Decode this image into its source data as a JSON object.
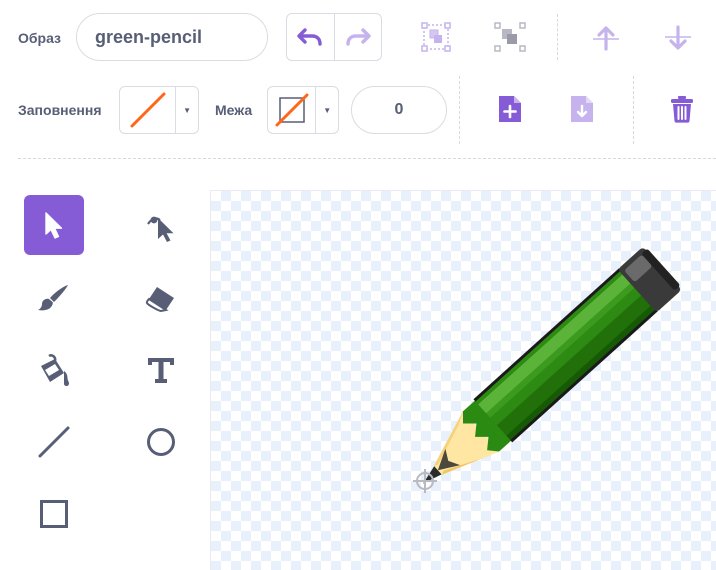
{
  "costume": {
    "label": "Образ",
    "name": "green-pencil"
  },
  "fill": {
    "label": "Заповнення",
    "color": "#ff6619"
  },
  "outline": {
    "label": "Межа",
    "color": "#ff6619",
    "width": "0"
  },
  "toolbar": {
    "undo_icon": "undo-icon",
    "redo_icon": "redo-icon",
    "group_icon": "group-icon",
    "ungroup_icon": "ungroup-icon",
    "forward_icon": "arrow-up-icon",
    "backward_icon": "arrow-down-icon",
    "paste_icon": "page-add-icon",
    "copy_icon": "page-download-icon",
    "delete_icon": "trash-icon"
  },
  "tools": [
    {
      "name": "select",
      "icon": "cursor-icon",
      "active": true
    },
    {
      "name": "reshape",
      "icon": "reshape-icon",
      "active": false
    },
    {
      "name": "brush",
      "icon": "brush-icon",
      "active": false
    },
    {
      "name": "eraser",
      "icon": "eraser-icon",
      "active": false
    },
    {
      "name": "fill",
      "icon": "paint-bucket-icon",
      "active": false
    },
    {
      "name": "text",
      "icon": "text-icon",
      "active": false
    },
    {
      "name": "line",
      "icon": "line-icon",
      "active": false
    },
    {
      "name": "circle",
      "icon": "circle-icon",
      "active": false
    },
    {
      "name": "rectangle",
      "icon": "rectangle-icon",
      "active": false
    }
  ],
  "colors": {
    "accent": "#855cd6",
    "accent_light": "#c6b3ee",
    "text": "#575e75",
    "border": "#d9dce3",
    "checker": "#e8f0fb",
    "pencil_green": "#2d8a12"
  }
}
